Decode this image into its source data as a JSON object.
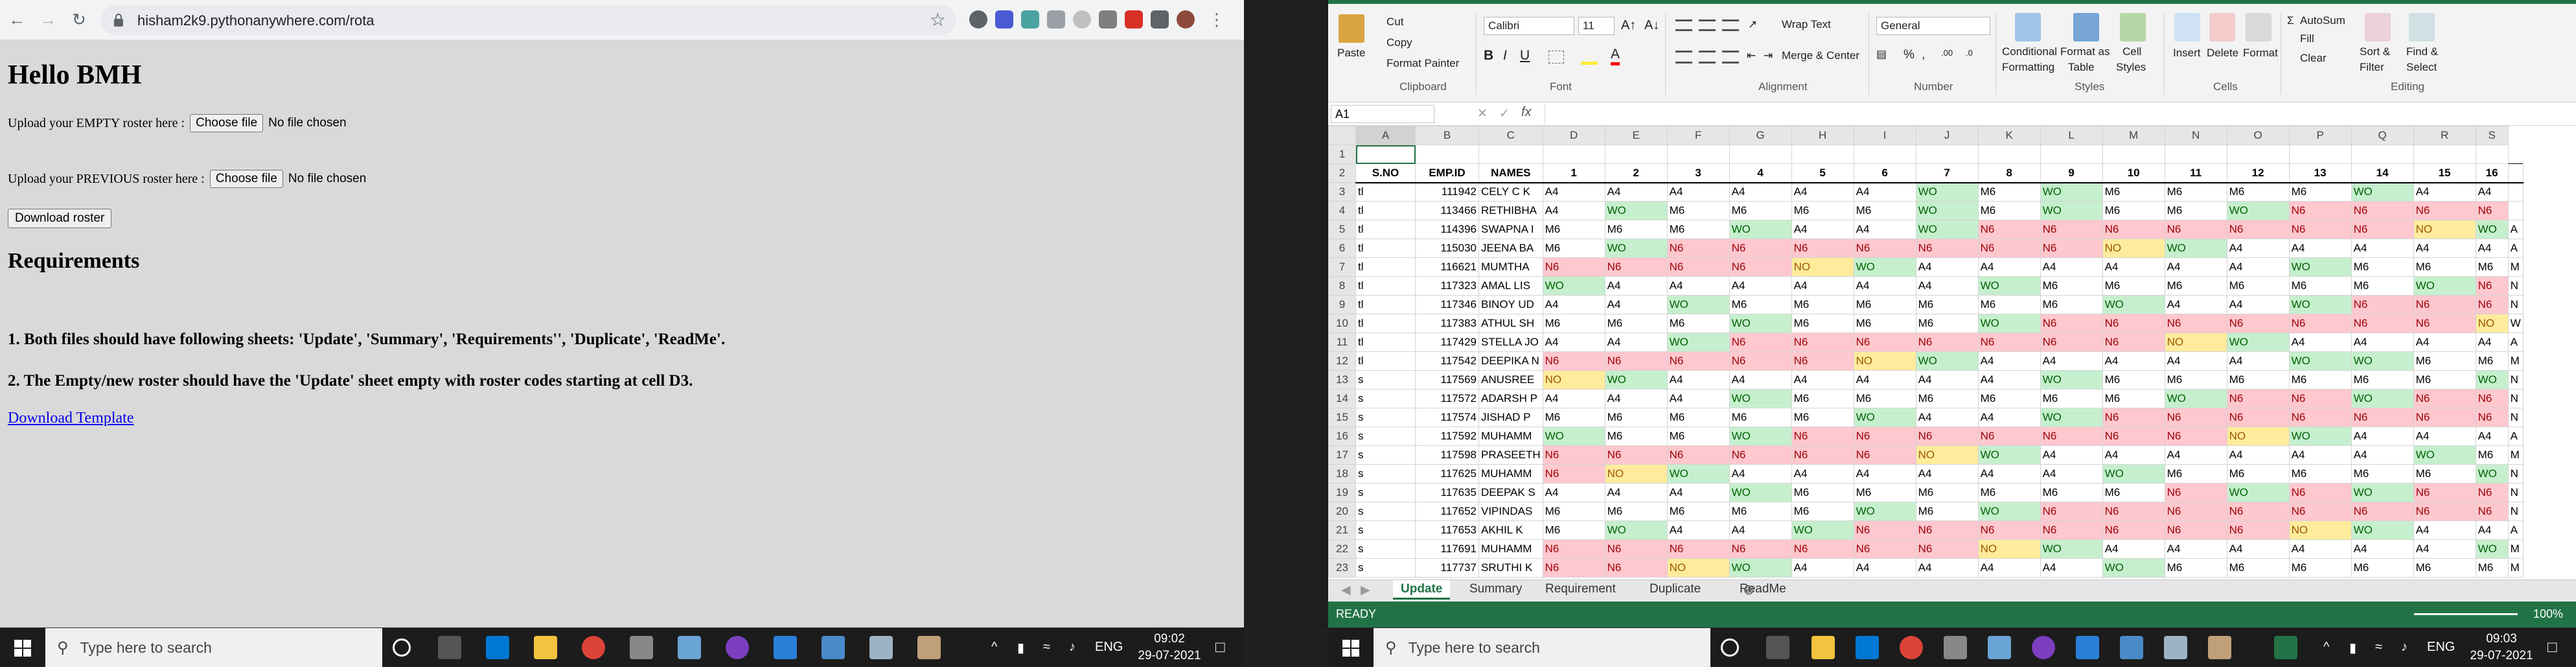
{
  "browser": {
    "url": "hisham2k9.pythonanywhere.com/rota"
  },
  "page": {
    "title": "Hello BMH",
    "empty_label": "Upload your EMPTY roster here :",
    "previous_label": "Upload your PREVIOUS roster here :",
    "choose_file": "Choose file",
    "no_file": "No file chosen",
    "download_roster": "Download roster",
    "requirements_heading": "Requirements",
    "req1": "1. Both files should have following sheets: 'Update', 'Summary', 'Requirements'', 'Duplicate', 'ReadMe'.",
    "req2": "2. The Empty/new roster should have the 'Update' sheet empty with roster codes starting at cell D3.",
    "template_link": "Download Template"
  },
  "taskbar_left": {
    "search_placeholder": "Type here to search",
    "lang": "ENG",
    "time": "09:02",
    "date": "29-07-2021"
  },
  "taskbar_right": {
    "search_placeholder": "Type here to search",
    "lang": "ENG",
    "time": "09:03",
    "date": "29-07-2021"
  },
  "excel": {
    "clipboard": {
      "paste": "Paste",
      "cut": "Cut",
      "copy": "Copy",
      "format_painter": "Format Painter",
      "label": "Clipboard"
    },
    "font": {
      "name": "Calibri",
      "size": "11",
      "label": "Font"
    },
    "alignment": {
      "wrap": "Wrap Text",
      "merge": "Merge & Center",
      "label": "Alignment"
    },
    "number": {
      "format": "General",
      "label": "Number"
    },
    "styles": {
      "conditional": "Conditional",
      "formatting": "Formatting",
      "format_as": "Format as",
      "table": "Table",
      "cell": "Cell",
      "styles": "Styles",
      "label": "Styles"
    },
    "cells": {
      "insert": "Insert",
      "delete": "Delete",
      "format": "Format",
      "label": "Cells"
    },
    "editing": {
      "autosum": "AutoSum",
      "fill": "Fill",
      "clear": "Clear",
      "sort": "Sort &",
      "filter": "Filter",
      "find": "Find &",
      "select": "Select",
      "label": "Editing"
    },
    "name_box": "A1",
    "fx": "fx",
    "columns": [
      "A",
      "B",
      "C",
      "D",
      "E",
      "F",
      "G",
      "H",
      "I",
      "J",
      "K",
      "L",
      "M",
      "N",
      "O",
      "P",
      "Q",
      "R",
      "S"
    ],
    "header_row": [
      "",
      "S.NO",
      "EMP.ID",
      "NAMES",
      "1",
      "2",
      "3",
      "4",
      "5",
      "6",
      "7",
      "8",
      "9",
      "10",
      "11",
      "12",
      "13",
      "14",
      "15",
      "16"
    ],
    "rows": [
      {
        "n": "3",
        "a": "tl",
        "id": "111942",
        "name": "CELY C K",
        "c": [
          "A4",
          "A4",
          "A4",
          "A4",
          "A4",
          "A4",
          "WO",
          "M6",
          "WO",
          "M6",
          "M6",
          "M6",
          "M6",
          "WO",
          "A4",
          "A4",
          ""
        ]
      },
      {
        "n": "4",
        "a": "tl",
        "id": "113466",
        "name": "RETHIBHA",
        "c": [
          "A4",
          "WO",
          "M6",
          "M6",
          "M6",
          "M6",
          "WO",
          "M6",
          "WO",
          "M6",
          "M6",
          "WO",
          "N6",
          "N6",
          "N6",
          "N6",
          ""
        ]
      },
      {
        "n": "5",
        "a": "tl",
        "id": "114396",
        "name": "SWAPNA I",
        "c": [
          "M6",
          "M6",
          "M6",
          "WO",
          "A4",
          "A4",
          "WO",
          "N6",
          "N6",
          "N6",
          "N6",
          "N6",
          "N6",
          "N6",
          "NO",
          "WO",
          "A"
        ]
      },
      {
        "n": "6",
        "a": "tl",
        "id": "115030",
        "name": "JEENA BA",
        "c": [
          "M6",
          "WO",
          "N6",
          "N6",
          "N6",
          "N6",
          "N6",
          "N6",
          "N6",
          "NO",
          "WO",
          "A4",
          "A4",
          "A4",
          "A4",
          "A4",
          "A"
        ]
      },
      {
        "n": "7",
        "a": "tl",
        "id": "116621",
        "name": "MUMTHA",
        "c": [
          "N6",
          "N6",
          "N6",
          "N6",
          "NO",
          "WO",
          "A4",
          "A4",
          "A4",
          "A4",
          "A4",
          "A4",
          "WO",
          "M6",
          "M6",
          "M6",
          "M"
        ]
      },
      {
        "n": "8",
        "a": "tl",
        "id": "117323",
        "name": "AMAL LIS",
        "c": [
          "WO",
          "A4",
          "A4",
          "A4",
          "A4",
          "A4",
          "A4",
          "WO",
          "M6",
          "M6",
          "M6",
          "M6",
          "M6",
          "M6",
          "WO",
          "N6",
          "N"
        ]
      },
      {
        "n": "9",
        "a": "tl",
        "id": "117346",
        "name": "BINOY UD",
        "c": [
          "A4",
          "A4",
          "WO",
          "M6",
          "M6",
          "M6",
          "M6",
          "M6",
          "M6",
          "WO",
          "A4",
          "A4",
          "WO",
          "N6",
          "N6",
          "N6",
          "N"
        ]
      },
      {
        "n": "10",
        "a": "tl",
        "id": "117383",
        "name": "ATHUL SH",
        "c": [
          "M6",
          "M6",
          "M6",
          "WO",
          "M6",
          "M6",
          "M6",
          "WO",
          "N6",
          "N6",
          "N6",
          "N6",
          "N6",
          "N6",
          "N6",
          "NO",
          "W"
        ]
      },
      {
        "n": "11",
        "a": "tl",
        "id": "117429",
        "name": "STELLA JO",
        "c": [
          "A4",
          "A4",
          "WO",
          "N6",
          "N6",
          "N6",
          "N6",
          "N6",
          "N6",
          "N6",
          "NO",
          "WO",
          "A4",
          "A4",
          "A4",
          "A4",
          "A"
        ]
      },
      {
        "n": "12",
        "a": "tl",
        "id": "117542",
        "name": "DEEPIKA N",
        "c": [
          "N6",
          "N6",
          "N6",
          "N6",
          "N6",
          "NO",
          "WO",
          "A4",
          "A4",
          "A4",
          "A4",
          "A4",
          "WO",
          "WO",
          "M6",
          "M6",
          "M"
        ]
      },
      {
        "n": "13",
        "a": "s",
        "id": "117569",
        "name": "ANUSREE",
        "c": [
          "NO",
          "WO",
          "A4",
          "A4",
          "A4",
          "A4",
          "A4",
          "A4",
          "WO",
          "M6",
          "M6",
          "M6",
          "M6",
          "M6",
          "M6",
          "WO",
          "N"
        ]
      },
      {
        "n": "14",
        "a": "s",
        "id": "117572",
        "name": "ADARSH P",
        "c": [
          "A4",
          "A4",
          "A4",
          "WO",
          "M6",
          "M6",
          "M6",
          "M6",
          "M6",
          "M6",
          "WO",
          "N6",
          "N6",
          "WO",
          "N6",
          "N6",
          "N"
        ]
      },
      {
        "n": "15",
        "a": "s",
        "id": "117574",
        "name": "JISHAD P",
        "c": [
          "M6",
          "M6",
          "M6",
          "M6",
          "M6",
          "WO",
          "A4",
          "A4",
          "WO",
          "N6",
          "N6",
          "N6",
          "N6",
          "N6",
          "N6",
          "N6",
          "N"
        ]
      },
      {
        "n": "16",
        "a": "s",
        "id": "117592",
        "name": "MUHAMM",
        "c": [
          "WO",
          "M6",
          "M6",
          "WO",
          "N6",
          "N6",
          "N6",
          "N6",
          "N6",
          "N6",
          "N6",
          "NO",
          "WO",
          "A4",
          "A4",
          "A4",
          "A"
        ]
      },
      {
        "n": "17",
        "a": "s",
        "id": "117598",
        "name": "PRASEETH",
        "c": [
          "N6",
          "N6",
          "N6",
          "N6",
          "N6",
          "N6",
          "NO",
          "WO",
          "A4",
          "A4",
          "A4",
          "A4",
          "A4",
          "A4",
          "WO",
          "M6",
          "M"
        ]
      },
      {
        "n": "18",
        "a": "s",
        "id": "117625",
        "name": "MUHAMM",
        "c": [
          "N6",
          "NO",
          "WO",
          "A4",
          "A4",
          "A4",
          "A4",
          "A4",
          "A4",
          "WO",
          "M6",
          "M6",
          "M6",
          "M6",
          "M6",
          "WO",
          "N"
        ]
      },
      {
        "n": "19",
        "a": "s",
        "id": "117635",
        "name": "DEEPAK S",
        "c": [
          "A4",
          "A4",
          "A4",
          "WO",
          "M6",
          "M6",
          "M6",
          "M6",
          "M6",
          "M6",
          "N6",
          "WO",
          "N6",
          "WO",
          "N6",
          "N6",
          "N"
        ]
      },
      {
        "n": "20",
        "a": "s",
        "id": "117652",
        "name": "VIPINDAS",
        "c": [
          "M6",
          "M6",
          "M6",
          "M6",
          "M6",
          "WO",
          "M6",
          "WO",
          "N6",
          "N6",
          "N6",
          "N6",
          "N6",
          "N6",
          "N6",
          "N6",
          "N"
        ]
      },
      {
        "n": "21",
        "a": "s",
        "id": "117653",
        "name": "AKHIL K",
        "c": [
          "M6",
          "WO",
          "A4",
          "A4",
          "WO",
          "N6",
          "N6",
          "N6",
          "N6",
          "N6",
          "N6",
          "N6",
          "NO",
          "WO",
          "A4",
          "A4",
          "A"
        ]
      },
      {
        "n": "22",
        "a": "s",
        "id": "117691",
        "name": "MUHAMM",
        "c": [
          "N6",
          "N6",
          "N6",
          "N6",
          "N6",
          "N6",
          "N6",
          "NO",
          "WO",
          "A4",
          "A4",
          "A4",
          "A4",
          "A4",
          "A4",
          "WO",
          "M"
        ]
      },
      {
        "n": "23",
        "a": "s",
        "id": "117737",
        "name": "SRUTHI K",
        "c": [
          "N6",
          "N6",
          "NO",
          "WO",
          "A4",
          "A4",
          "A4",
          "A4",
          "A4",
          "WO",
          "M6",
          "M6",
          "M6",
          "M6",
          "M6",
          "M6",
          "M"
        ]
      }
    ],
    "sheet_tabs": [
      "Update",
      "Summary",
      "Requirement",
      "Duplicate",
      "ReadMe"
    ],
    "status": "READY",
    "zoom": "100%"
  }
}
